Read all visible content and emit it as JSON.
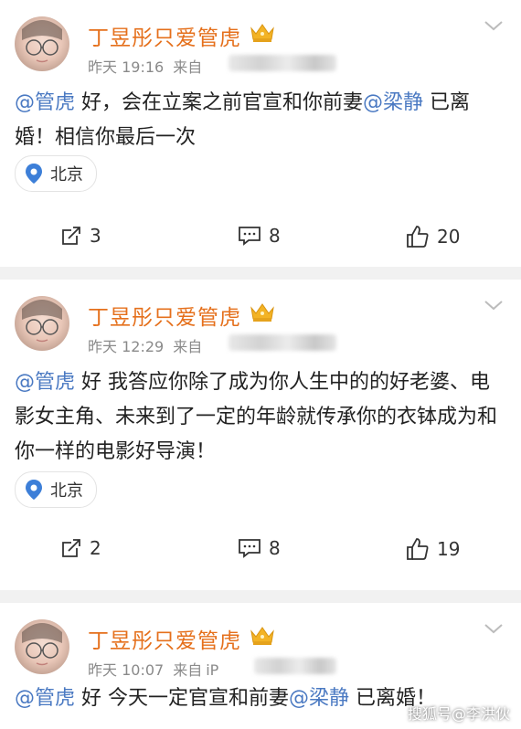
{
  "posts": [
    {
      "username": "丁昱彤只爱管虎",
      "time": "昨天 19:16",
      "source_prefix": "来自",
      "content": [
        {
          "t": "@管虎",
          "m": true
        },
        {
          "t": " 好，会在立案之前官宣和你前妻",
          "m": false
        },
        {
          "t": "@梁静",
          "m": true
        },
        {
          "t": " 已离婚！相信你最后一次",
          "m": false
        }
      ],
      "location": "北京",
      "reposts": "3",
      "comments": "8",
      "likes": "20"
    },
    {
      "username": "丁昱彤只爱管虎",
      "time": "昨天 12:29",
      "source_prefix": "来自",
      "content": [
        {
          "t": "@管虎",
          "m": true
        },
        {
          "t": " 好 我答应你除了成为你人生中的的好老婆、电影女主角、未来到了一定的年龄就传承你的衣钵成为和你一样的电影好导演！",
          "m": false
        }
      ],
      "location": "北京",
      "reposts": "2",
      "comments": "8",
      "likes": "19"
    },
    {
      "username": "丁昱彤只爱管虎",
      "time": "昨天 10:07",
      "source_prefix": "来自",
      "source_partial": "iP",
      "content": [
        {
          "t": "@管虎",
          "m": true
        },
        {
          "t": " 好 今天一定官宣和前妻",
          "m": false
        },
        {
          "t": "@梁静",
          "m": true
        },
        {
          "t": " 已离婚！",
          "m": false
        }
      ]
    }
  ],
  "watermark": "搜狐号@李洪伙",
  "colors": {
    "username": "#e5701c",
    "mention": "#4a79c2",
    "meta": "#8a8a8a",
    "separator": "#f1f1f1"
  }
}
